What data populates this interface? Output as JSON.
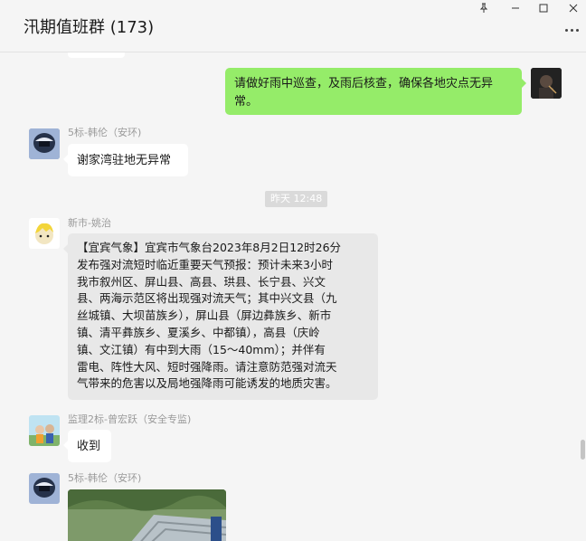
{
  "window": {
    "title": "汛期值班群 (173)",
    "controls": [
      "pin-icon",
      "minimize-icon",
      "maximize-icon",
      "close-icon"
    ],
    "more_icon": "more-icon"
  },
  "messages": {
    "m1": {
      "text": "请做好雨中巡查，及雨后核查，确保各地灾点无异常。",
      "side": "right",
      "bubble_color": "#95ec69"
    },
    "m2": {
      "sender": "5标-韩伦（安环)",
      "text": "谢家湾驻地无异常"
    },
    "timestamp": "昨天 12:48",
    "m3": {
      "sender": "新市-姚治",
      "lines": [
        "【宜宾气象】宜宾市气象台2023年8月2日12时26分",
        "发布强对流短时临近重要天气预报：预计未来3小时",
        "我市叙州区、屏山县、高县、珙县、长宁县、兴文",
        "县、两海示范区将出现强对流天气；其中兴文县（九",
        "丝城镇、大坝苗族乡），屏山县（屏边彝族乡、新市",
        "镇、清平彝族乡、夏溪乡、中都镇），高县（庆岭",
        "镇、文江镇）有中到大雨（15～40mm）；并伴有",
        "雷电、阵性大风、短时强降雨。请注意防范强对流天",
        "气带来的危害以及局地强降雨可能诱发的地质灾害。"
      ]
    },
    "m4": {
      "sender": "监理2标-曾宏跃（安全专监)",
      "text": "收到"
    },
    "m5": {
      "sender": "5标-韩伦（安环)"
    }
  },
  "colors": {
    "background": "#f5f5f5",
    "green_bubble": "#95ec69",
    "white_bubble": "#ffffff",
    "gray_bubble": "#e8e8e8"
  }
}
